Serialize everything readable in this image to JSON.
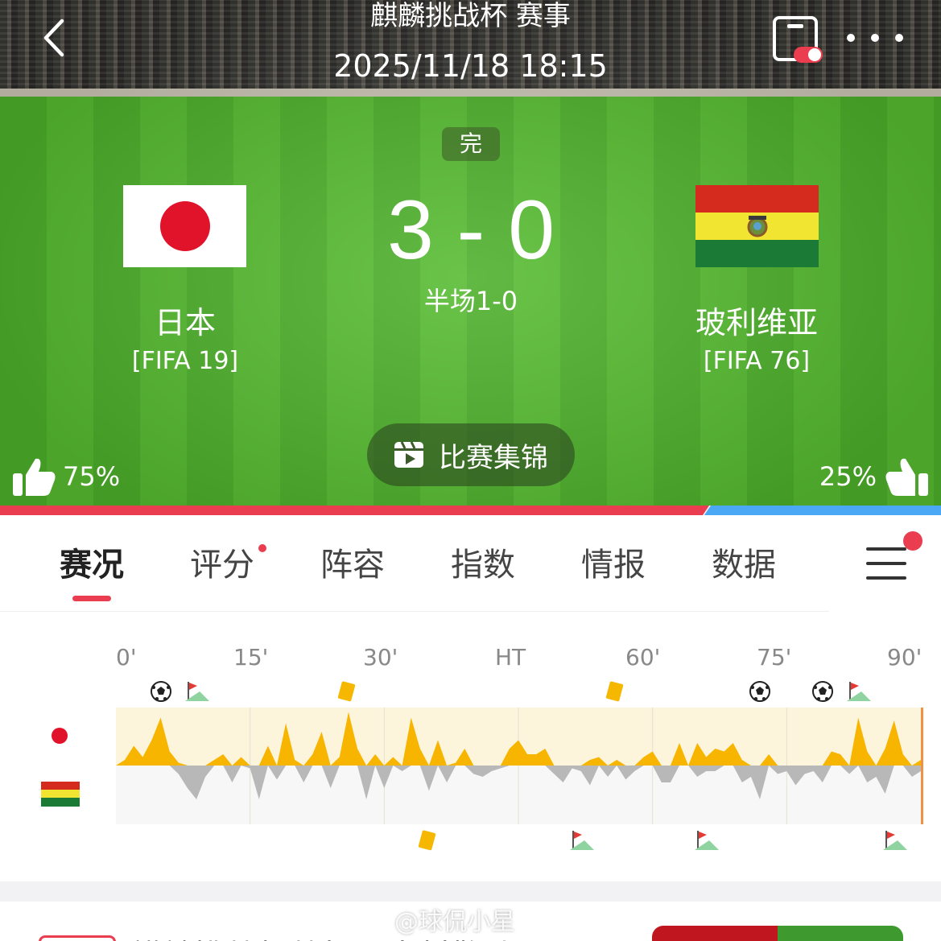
{
  "header": {
    "event_title": "麒麟挑战杯 赛事",
    "datetime": "2025/11/18 18:15"
  },
  "match": {
    "status": "完",
    "score": "3 - 0",
    "halftime": "半场1-0",
    "home": {
      "name": "日本",
      "rank": "[FIFA 19]",
      "flag_colors": [
        "#ffffff",
        "#e0132a"
      ]
    },
    "away": {
      "name": "玻利维亚",
      "rank": "[FIFA 76]",
      "flag_colors": [
        "#d52b1e",
        "#f9e300",
        "#007934"
      ]
    }
  },
  "highlights_label": "比赛集锦",
  "support": {
    "home_percent": "75%",
    "away_percent": "25%",
    "home_fraction": 0.75
  },
  "colors": {
    "accent": "#ea3e50",
    "home_bar": "#ea3e50",
    "away_bar": "#4aa8f5",
    "momentum_home": "#f7b500",
    "momentum_away": "#b8b8b8"
  },
  "tabs": [
    {
      "label": "赛况",
      "active": true
    },
    {
      "label": "评分",
      "badge": true
    },
    {
      "label": "阵容"
    },
    {
      "label": "指数"
    },
    {
      "label": "情报"
    },
    {
      "label": "数据"
    }
  ],
  "timeline": {
    "ticks": [
      "0'",
      "15'",
      "30'",
      "HT",
      "60'",
      "75'",
      "90'"
    ],
    "home_events": [
      {
        "type": "goal",
        "minute": 5
      },
      {
        "type": "corner",
        "minute": 9
      },
      {
        "type": "yellow-card",
        "minute": 26
      },
      {
        "type": "yellow-card",
        "minute": 56
      },
      {
        "type": "goal",
        "minute": 72
      },
      {
        "type": "goal",
        "minute": 79
      },
      {
        "type": "corner",
        "minute": 83
      }
    ],
    "away_events": [
      {
        "type": "yellow-card",
        "minute": 35
      },
      {
        "type": "corner",
        "minute": 52
      },
      {
        "type": "corner",
        "minute": 66
      },
      {
        "type": "corner",
        "minute": 87
      }
    ]
  },
  "chart_data": {
    "type": "area",
    "title": "",
    "xlabel": "",
    "ylabel": "",
    "x_ticks": [
      "0'",
      "15'",
      "30'",
      "HT",
      "60'",
      "75'",
      "90'"
    ],
    "xlim": [
      0,
      90
    ],
    "ylim": [
      -1,
      1
    ],
    "series": [
      {
        "values": [
          0,
          0.1,
          0.35,
          0.15,
          0.45,
          0.85,
          0.25,
          0.05,
          0,
          0,
          0,
          0.1,
          0.2,
          0,
          0.15,
          0,
          0,
          0.35,
          0,
          0.75,
          0.1,
          0,
          0.2,
          0.6,
          0,
          0.15,
          0.95,
          0.3,
          0,
          0.2,
          0,
          0.15,
          0,
          0.85,
          0.3,
          0,
          0.45,
          0,
          0.05,
          0.3,
          0,
          0,
          0,
          0,
          0.3,
          0.45,
          0.2,
          0.2,
          0.3,
          0,
          0,
          0,
          0,
          0.1,
          0.15,
          0,
          0.1,
          0,
          0,
          0.15,
          0.25,
          0,
          0,
          0.4,
          0,
          0.4,
          0.15,
          0.3,
          0.25,
          0.4,
          0.1,
          0,
          0,
          0.2,
          0,
          0,
          0,
          0,
          0,
          0,
          0.25,
          0.2,
          0,
          0.85,
          0.25,
          0,
          0.3,
          0.8,
          0.2,
          0,
          0.1
        ],
        "away_values": [
          0,
          0,
          0,
          0,
          0,
          0,
          0,
          0.15,
          0.4,
          0.6,
          0.2,
          0,
          0,
          0.3,
          0,
          0.05,
          0.6,
          0,
          0.25,
          0,
          0,
          0.3,
          0,
          0,
          0.4,
          0,
          0,
          0,
          0.6,
          0,
          0.4,
          0,
          0.1,
          0,
          0,
          0.45,
          0,
          0.3,
          0,
          0,
          0.15,
          0.2,
          0.1,
          0.05,
          0,
          0,
          0,
          0,
          0,
          0.15,
          0.3,
          0.05,
          0.1,
          0.35,
          0,
          0.2,
          0,
          0.25,
          0.1,
          0,
          0,
          0.3,
          0.3,
          0,
          0,
          0.2,
          0.1,
          0.1,
          0,
          0,
          0.3,
          0.2,
          0.6,
          0,
          0.15,
          0.1,
          0.35,
          0.15,
          0.1,
          0.3,
          0,
          0,
          0.15,
          0,
          0.3,
          0.2,
          0.5,
          0,
          0,
          0.2,
          0.1
        ]
      }
    ]
  },
  "bottom": {
    "title": "麒麟挑战杯战报：中村敬斗"
  },
  "watermark": "@球侃小星"
}
